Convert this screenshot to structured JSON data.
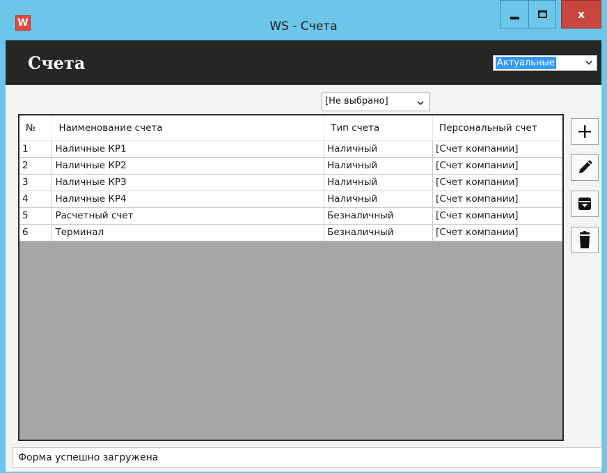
{
  "window": {
    "title": "WS - Счета",
    "app_icon_letter": "W",
    "close_label": "x",
    "accent_color": "#6cc6ea",
    "close_color": "#c7463d"
  },
  "header": {
    "title": "Счета",
    "status_filter": {
      "selected": "Актуальные"
    }
  },
  "type_filter": {
    "selected": "[Не выбрано]"
  },
  "table": {
    "columns": [
      "№",
      "Наименование счета",
      "Тип счета",
      "Персональный счет"
    ],
    "rows": [
      [
        "1",
        "Наличные КР1",
        "Наличный",
        "[Счет компании]"
      ],
      [
        "2",
        "Наличные КР2",
        "Наличный",
        "[Счет компании]"
      ],
      [
        "3",
        "Наличные КР3",
        "Наличный",
        "[Счет компании]"
      ],
      [
        "4",
        "Наличные КР4",
        "Наличный",
        "[Счет компании]"
      ],
      [
        "5",
        "Расчетный счет",
        "Безналичный",
        "[Счет компании]"
      ],
      [
        "6",
        "Терминал",
        "Безналичный",
        "[Счет компании]"
      ]
    ]
  },
  "actions": {
    "icons": [
      "plus-icon",
      "pencil-icon",
      "archive-icon",
      "trash-icon"
    ]
  },
  "status_bar": {
    "text": "Форма успешно загружена"
  }
}
